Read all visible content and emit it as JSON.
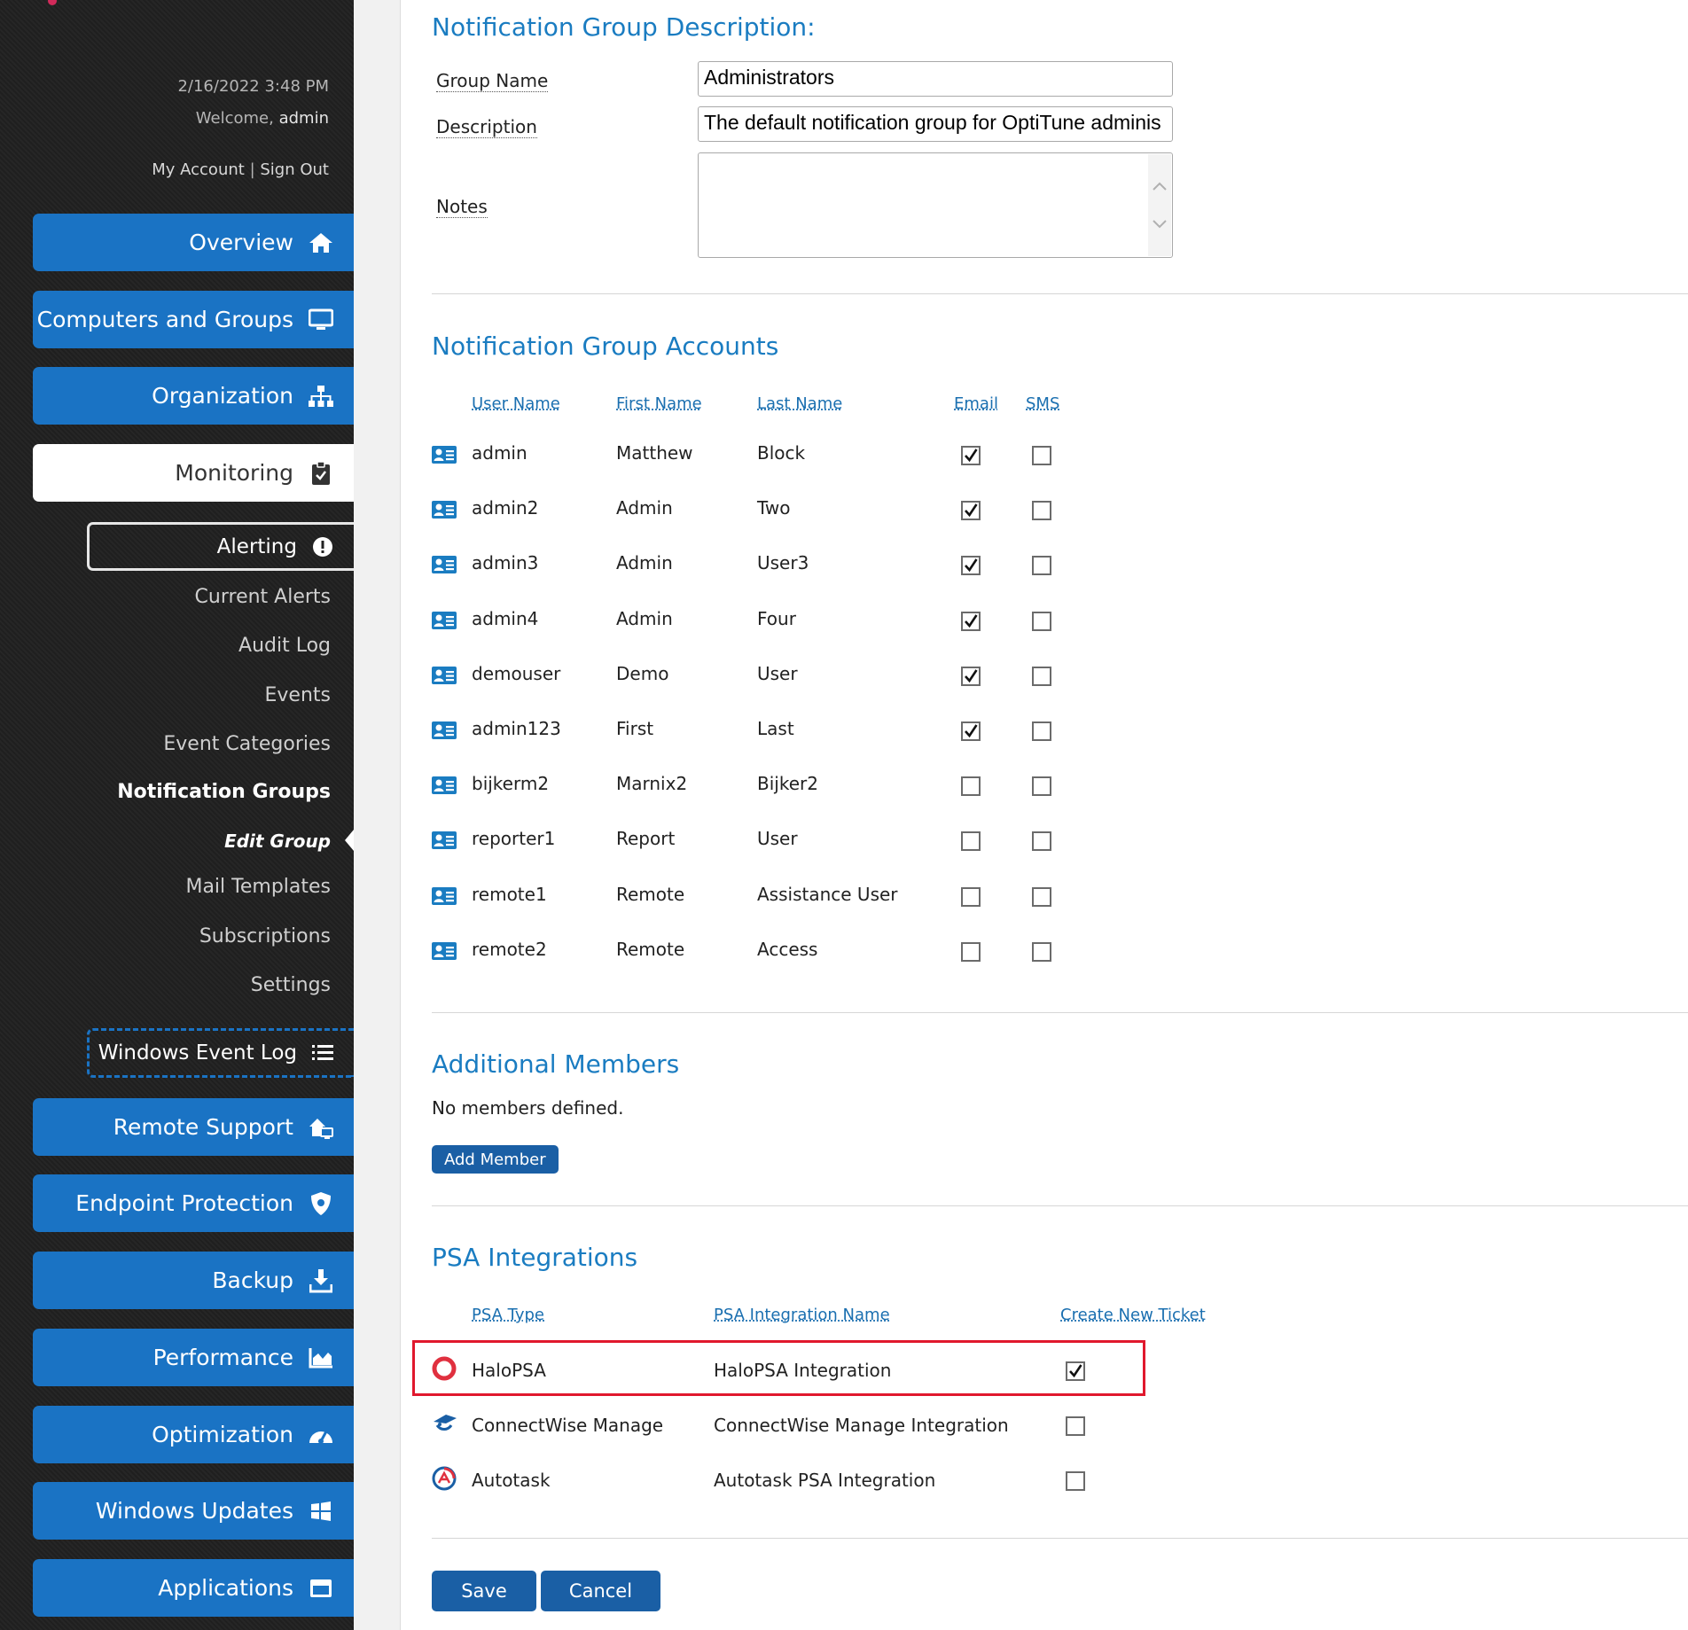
{
  "session": {
    "datetime": "2/16/2022 3:48 PM",
    "welcome_prefix": "Welcome,",
    "username": "admin",
    "my_account": "My Account",
    "separator": "|",
    "sign_out": "Sign Out"
  },
  "nav": {
    "overview": "Overview",
    "computers_and_groups": "Computers and Groups",
    "organization": "Organization",
    "monitoring": "Monitoring",
    "alerting": "Alerting",
    "monitoring_sub": {
      "current_alerts": "Current Alerts",
      "audit_log": "Audit Log",
      "events": "Events",
      "event_categories": "Event Categories",
      "notification_groups": "Notification Groups",
      "edit_group": "Edit Group",
      "mail_templates": "Mail Templates",
      "subscriptions": "Subscriptions",
      "settings": "Settings"
    },
    "windows_event_log": "Windows Event Log",
    "remote_support": "Remote Support",
    "endpoint_protection": "Endpoint Protection",
    "backup": "Backup",
    "performance": "Performance",
    "optimization": "Optimization",
    "windows_updates": "Windows Updates",
    "applications": "Applications"
  },
  "description_section": {
    "title": "Notification Group Description:",
    "group_name_label": "Group Name",
    "group_name_value": "Administrators",
    "description_label": "Description",
    "description_value": "The default notification group for OptiTune adminis",
    "notes_label": "Notes",
    "notes_value": ""
  },
  "accounts_section": {
    "title": "Notification Group Accounts",
    "columns": {
      "user_name": "User Name",
      "first_name": "First Name",
      "last_name": "Last Name",
      "email": "Email",
      "sms": "SMS"
    },
    "rows": [
      {
        "user": "admin",
        "first": "Matthew",
        "last": "Block",
        "email": true,
        "sms": false
      },
      {
        "user": "admin2",
        "first": "Admin",
        "last": "Two",
        "email": true,
        "sms": false
      },
      {
        "user": "admin3",
        "first": "Admin",
        "last": "User3",
        "email": true,
        "sms": false
      },
      {
        "user": "admin4",
        "first": "Admin",
        "last": "Four",
        "email": true,
        "sms": false
      },
      {
        "user": "demouser",
        "first": "Demo",
        "last": "User",
        "email": true,
        "sms": false
      },
      {
        "user": "admin123",
        "first": "First",
        "last": "Last",
        "email": true,
        "sms": false
      },
      {
        "user": "bijkerm2",
        "first": "Marnix2",
        "last": "Bijker2",
        "email": false,
        "sms": false
      },
      {
        "user": "reporter1",
        "first": "Report",
        "last": "User",
        "email": false,
        "sms": false
      },
      {
        "user": "remote1",
        "first": "Remote",
        "last": "Assistance User",
        "email": false,
        "sms": false
      },
      {
        "user": "remote2",
        "first": "Remote",
        "last": "Access",
        "email": false,
        "sms": false
      }
    ]
  },
  "members_section": {
    "title": "Additional Members",
    "empty_text": "No members defined.",
    "add_button": "Add Member"
  },
  "psa_section": {
    "title": "PSA Integrations",
    "columns": {
      "type": "PSA Type",
      "name": "PSA Integration Name",
      "create_ticket": "Create New Ticket"
    },
    "rows": [
      {
        "type": "HaloPSA",
        "name": "HaloPSA Integration",
        "create_ticket": true,
        "icon": "halopsa-icon"
      },
      {
        "type": "ConnectWise Manage",
        "name": "ConnectWise Manage Integration",
        "create_ticket": false,
        "icon": "connectwise-icon"
      },
      {
        "type": "Autotask",
        "name": "Autotask PSA Integration",
        "create_ticket": false,
        "icon": "autotask-icon"
      }
    ]
  },
  "actions": {
    "save": "Save",
    "cancel": "Cancel"
  },
  "colors": {
    "nav_blue": "#1a73c4",
    "title_blue": "#1a7cc1",
    "button_blue": "#1a5fa5",
    "highlight_red": "#e0182d"
  }
}
